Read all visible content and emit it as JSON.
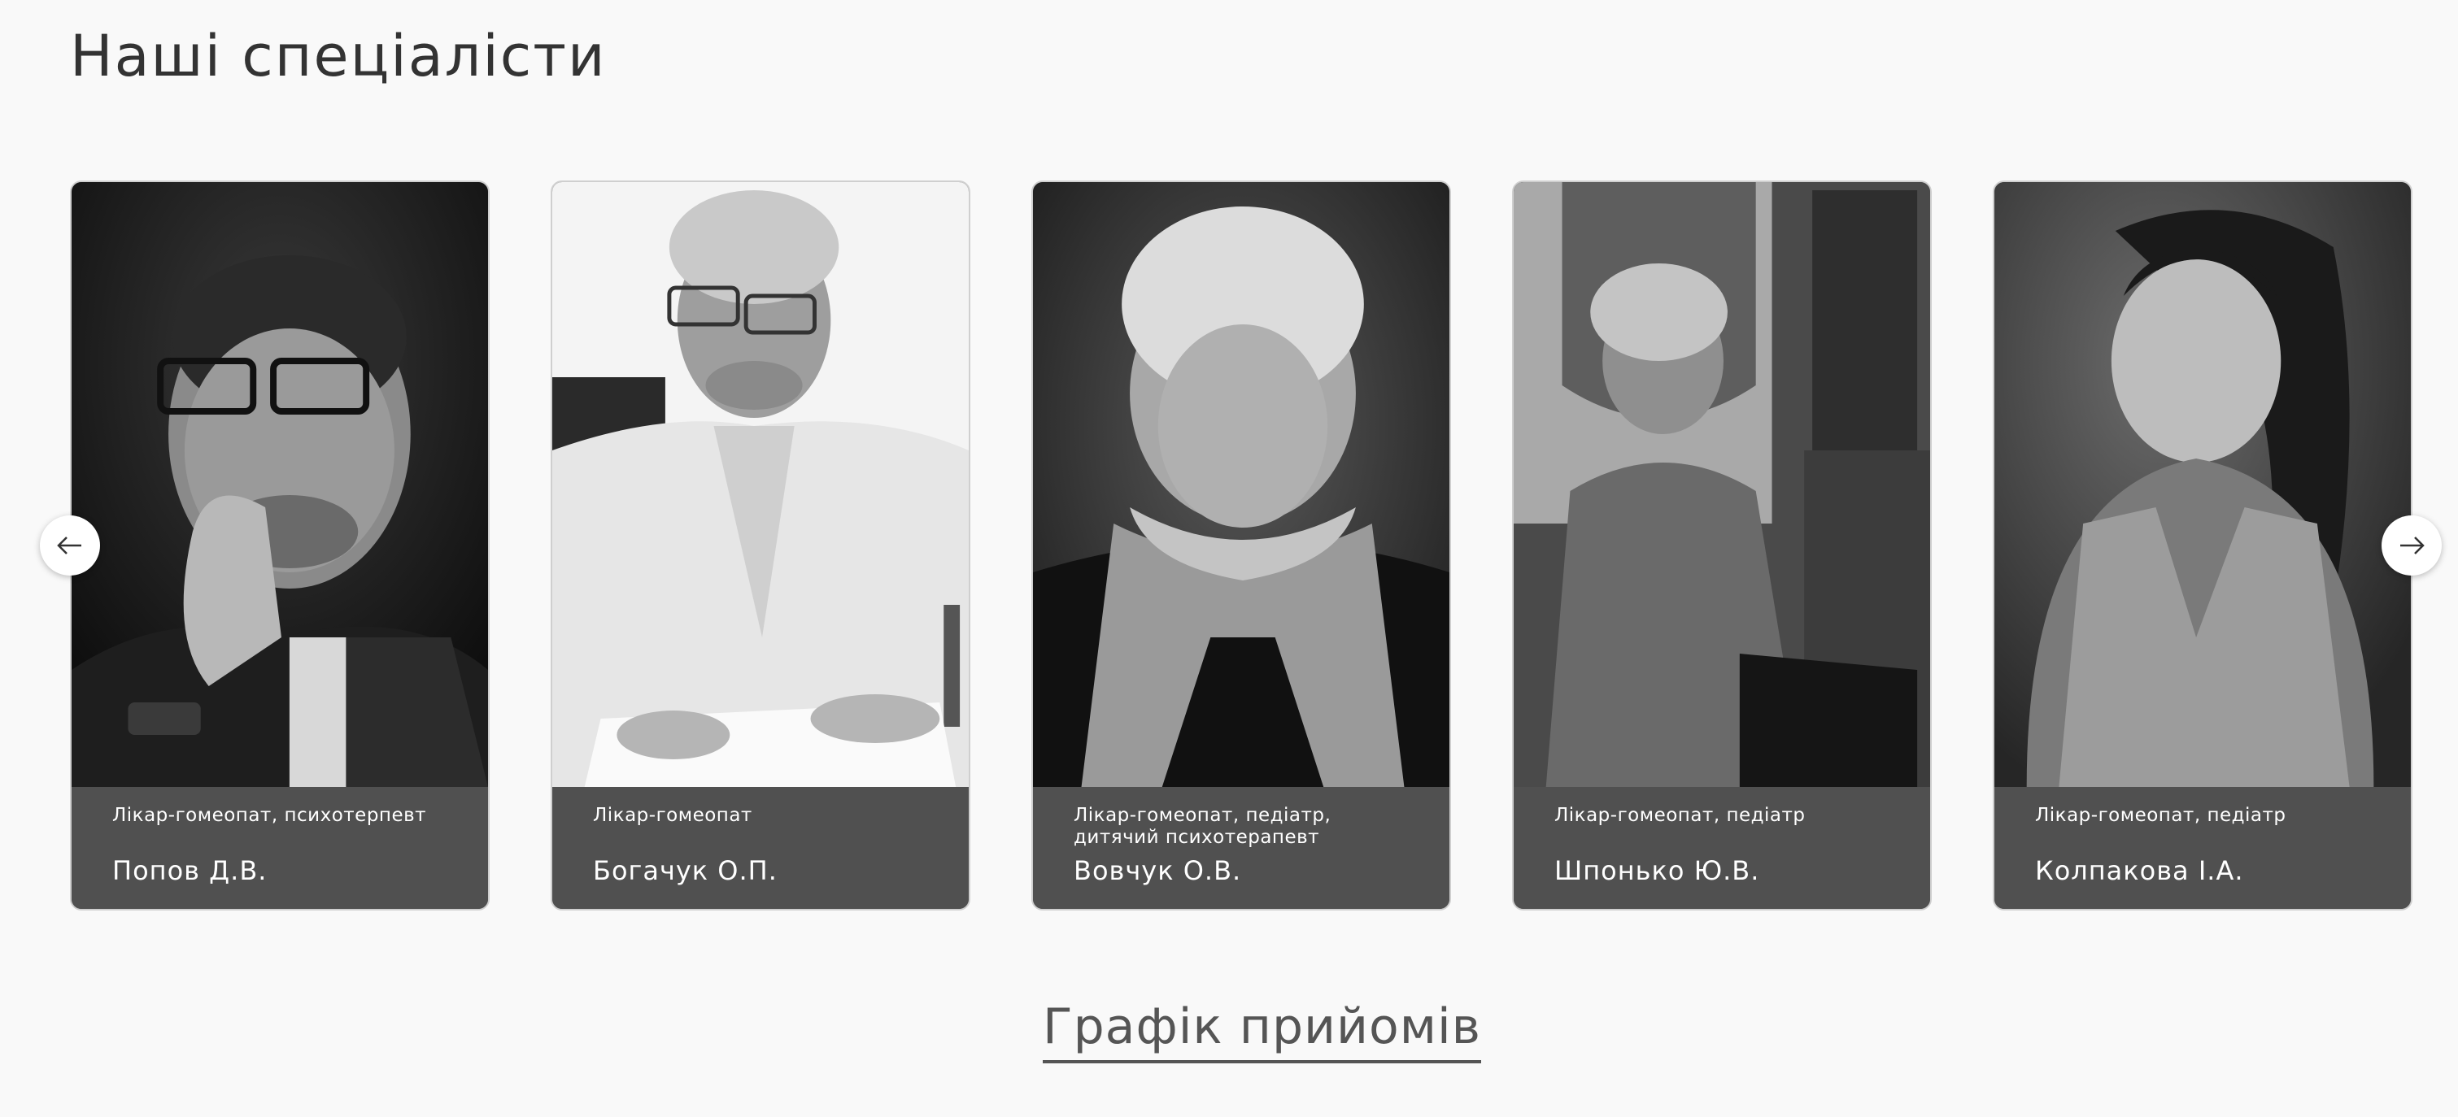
{
  "specialists_section": {
    "title": "Наші спеціалісти"
  },
  "carousel": {
    "prev_icon": "arrow-left-icon",
    "next_icon": "arrow-right-icon",
    "cards": [
      {
        "role": "Лікар-гомеопат, психотерпевт",
        "name": "Попов Д.В."
      },
      {
        "role": "Лікар-гомеопат",
        "name": "Богачук О.П."
      },
      {
        "role": "Лікар-гомеопат, педіатр, дитячий психотерапевт",
        "name": "Вовчук О.В."
      },
      {
        "role": "Лікар-гомеопат, педіатр",
        "name": "Шпонько Ю.В."
      },
      {
        "role": "Лікар-гомеопат, педіатр",
        "name": "Колпакова І.А."
      }
    ]
  },
  "schedule_section": {
    "title": "Графік прийомів"
  },
  "colors": {
    "page_background": "#f9f9f9",
    "card_info_background": "#505050",
    "card_text": "#ffffff",
    "heading": "#333333",
    "link_heading": "#555555"
  }
}
